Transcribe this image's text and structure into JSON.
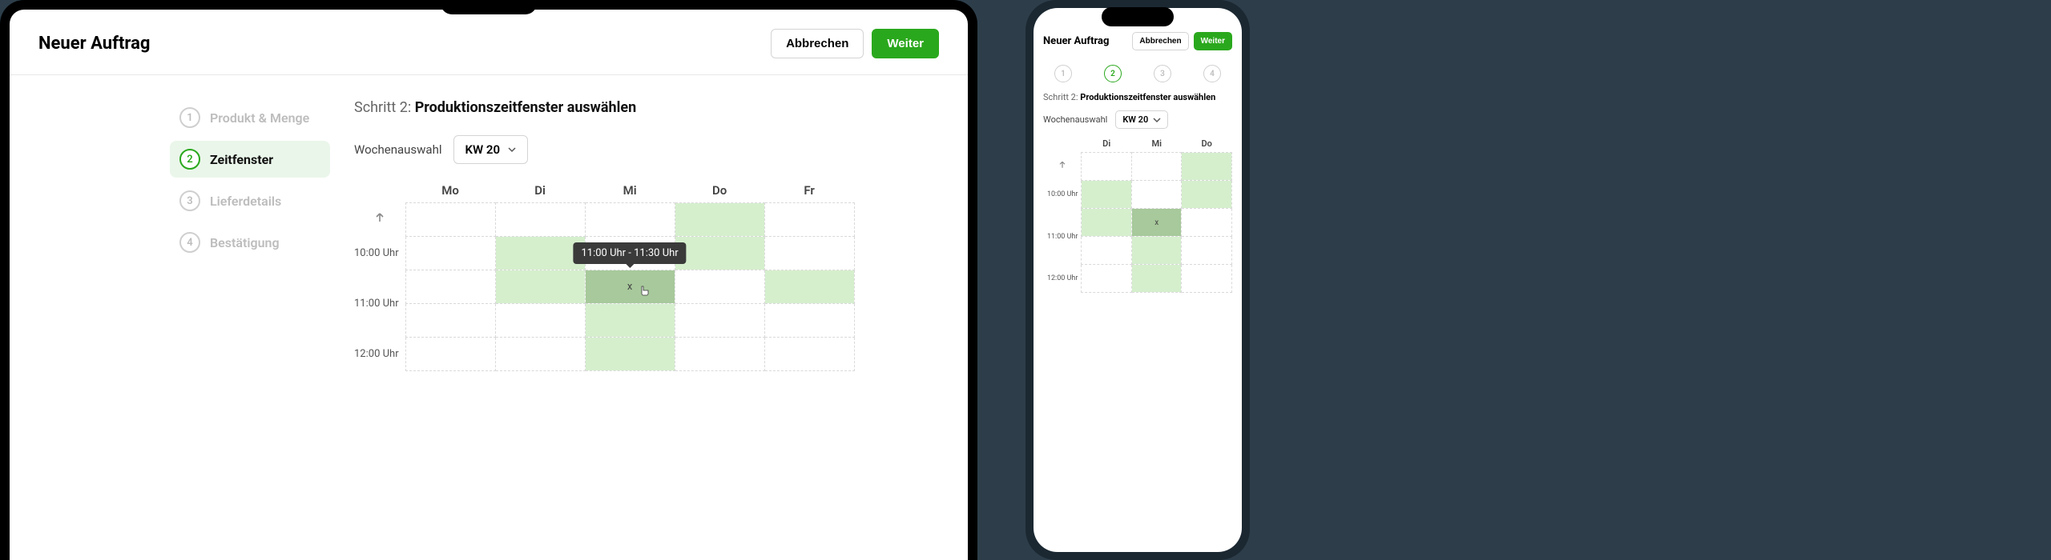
{
  "header": {
    "title": "Neuer Auftrag",
    "cancel": "Abbrechen",
    "next": "Weiter"
  },
  "steps": [
    {
      "num": "1",
      "label": "Produkt & Menge"
    },
    {
      "num": "2",
      "label": "Zeitfenster"
    },
    {
      "num": "3",
      "label": "Lieferdetails"
    },
    {
      "num": "4",
      "label": "Bestätigung"
    }
  ],
  "step_heading_prefix": "Schritt 2: ",
  "step_heading_strong": "Produktionszeitfenster auswählen",
  "week": {
    "label": "Wochenauswahl",
    "selected": "KW 20"
  },
  "calendar": {
    "days_tablet": [
      "Mo",
      "Di",
      "Mi",
      "Do",
      "Fr"
    ],
    "days_phone": [
      "Di",
      "Mi",
      "Do"
    ],
    "time_labels": [
      "10:00 Uhr",
      "11:00 Uhr",
      "12:00 Uhr"
    ],
    "tooltip": "11:00 Uhr - 11:30 Uhr",
    "remove_mark": "x"
  },
  "colors": {
    "primary": "#2aa81d",
    "slot_available": "#d5efcd",
    "slot_hover": "#a7c99b"
  }
}
